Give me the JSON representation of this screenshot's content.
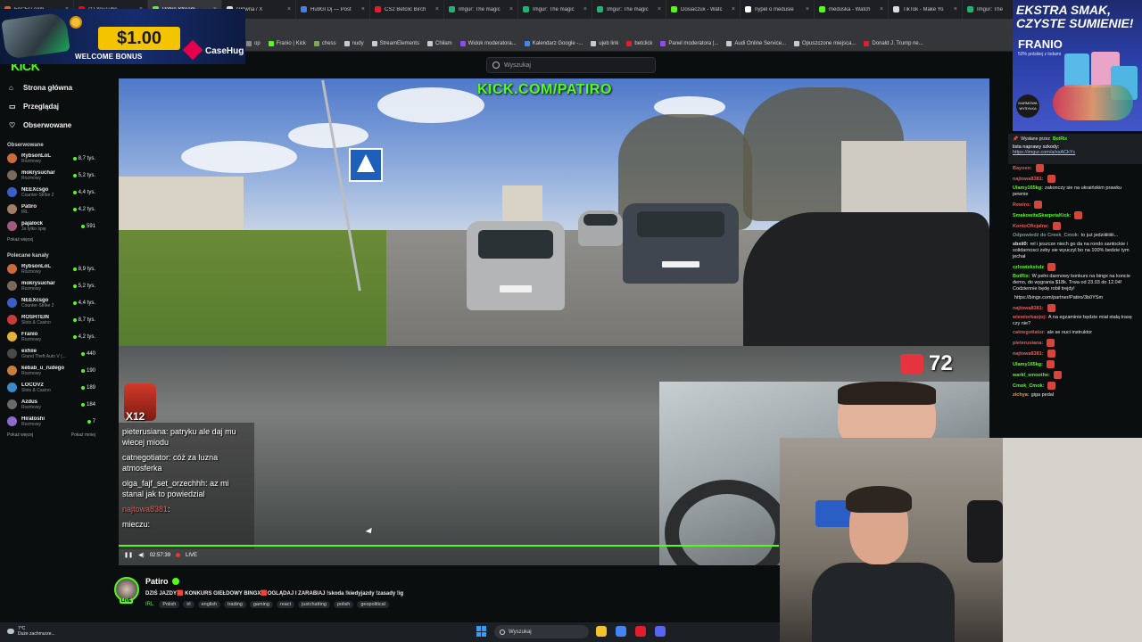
{
  "browser": {
    "tabs": [
      {
        "label": "FACEIT.com",
        "color": "#ff5500",
        "active": false
      },
      {
        "label": "(1) YouTube",
        "color": "#ff0000",
        "active": false
      },
      {
        "label": "Patiro Stream",
        "color": "#53fc18",
        "active": true
      },
      {
        "label": "Główna / X",
        "color": "#dddddd",
        "active": false
      },
      {
        "label": "Hu9Gl Dj — Post",
        "color": "#3b82f6",
        "active": false
      },
      {
        "label": "CS2 Betclic Birch",
        "color": "#e11d2e",
        "active": false
      },
      {
        "label": "Imgur: The magic",
        "color": "#1bb76e",
        "active": false
      },
      {
        "label": "Imgur: The magic",
        "color": "#1bb76e",
        "active": false
      },
      {
        "label": "Imgur: The magic",
        "color": "#1bb76e",
        "active": false
      },
      {
        "label": "Dosiaczux - Watc",
        "color": "#53fc18",
        "active": false
      },
      {
        "label": "nypel o medusie",
        "color": "#ffffff",
        "active": false
      },
      {
        "label": "meduska - Watch",
        "color": "#53fc18",
        "active": false
      },
      {
        "label": "TikTok - Make Yo",
        "color": "#dddddd",
        "active": false
      },
      {
        "label": "Imgur: The",
        "color": "#1bb76e",
        "active": false
      }
    ],
    "tab_close": "×",
    "bookmarks": [
      {
        "label": "op",
        "color": "#888888"
      },
      {
        "label": "Franio | Kick",
        "color": "#53fc18"
      },
      {
        "label": "chess",
        "color": "#7fa650"
      },
      {
        "label": "nudy",
        "color": "#c9c9c9"
      },
      {
        "label": "StreamElements",
        "color": "#c9c9c9"
      },
      {
        "label": "Chiłam",
        "color": "#c9c9c9"
      },
      {
        "label": "Widok moderatora...",
        "color": "#9146ff"
      },
      {
        "label": "Kalendarz Google -...",
        "color": "#4285f4"
      },
      {
        "label": "ujeb link",
        "color": "#c9c9c9"
      },
      {
        "label": "betclick",
        "color": "#e11d2e"
      },
      {
        "label": "Panel moderatora |...",
        "color": "#9146ff"
      },
      {
        "label": "Audi Online Service...",
        "color": "#c9c9c9"
      },
      {
        "label": "Opuszczone miejsca...",
        "color": "#c9c9c9"
      },
      {
        "label": "Donald J. Trump ne...",
        "color": "#e11d2e"
      }
    ]
  },
  "ad_left": {
    "amount": "$1.00",
    "text": "WELCOME BONUS",
    "brand": "CaseHug"
  },
  "ad_right": {
    "line1": "EKSTRA SMAK, CZYSTE SUMIENIE!",
    "line2": "FRANIO",
    "line3": "50% polskiej z lodami",
    "badge": "DARMOWA WYSYŁKA"
  },
  "header": {
    "logo": "KICK",
    "search_placeholder": "Wyszukaj",
    "menu": "≡"
  },
  "sidebar": {
    "nav": [
      {
        "label": "Strona główna",
        "icon": "home-icon",
        "glyph": "⌂"
      },
      {
        "label": "Przeglądaj",
        "icon": "browse-icon",
        "glyph": "▭"
      },
      {
        "label": "Obserwowane",
        "icon": "heart-icon",
        "glyph": "♡"
      }
    ],
    "followed_title": "Obserwowane",
    "followed": [
      {
        "name": "RybsonLoL",
        "category": "Rozmowy",
        "viewers": "8,7 tys.",
        "color": "#c96b3b"
      },
      {
        "name": "mokrysuchar",
        "category": "Rozmowy",
        "viewers": "5,2 tys.",
        "color": "#7b6a5c"
      },
      {
        "name": "NEEXcsgo",
        "category": "Counter-Strike 2",
        "viewers": "4,4 tys.",
        "color": "#3b5ec9"
      },
      {
        "name": "Patiro",
        "category": "IRL",
        "viewers": "4,2 tys.",
        "color": "#a37d64"
      },
      {
        "name": "pajalock",
        "category": "Ja tylko śpię",
        "viewers": "591",
        "color": "#a05b7f"
      }
    ],
    "show_more_1": "Pokaż więcej",
    "recommended_title": "Polecane kanały",
    "recommended": [
      {
        "name": "RybsonLoL",
        "category": "Rozmowy",
        "viewers": "8,9 tys.",
        "color": "#c96b3b"
      },
      {
        "name": "mokrysuchar",
        "category": "Rozmowy",
        "viewers": "5,2 tys.",
        "color": "#7b6a5c"
      },
      {
        "name": "NEEXcsgo",
        "category": "Counter-Strike 2",
        "viewers": "4,4 tys.",
        "color": "#3b5ec9"
      },
      {
        "name": "ROSHTEIN",
        "category": "Slots & Casino",
        "viewers": "8,7 tys.",
        "color": "#c93b3b"
      },
      {
        "name": "Franio",
        "category": "Rozmowy",
        "viewers": "4,2 tys.",
        "color": "#e3b23a"
      },
      {
        "name": "exhiie",
        "category": "Grand Theft Auto V (...",
        "viewers": "440",
        "color": "#4a4a4a"
      },
      {
        "name": "kebab_u_rudego",
        "category": "Rozmowy",
        "viewers": "190",
        "color": "#c97e3b"
      },
      {
        "name": "LOCOV2",
        "category": "Slots & Casino",
        "viewers": "189",
        "color": "#3b8ac9"
      },
      {
        "name": "Azdus",
        "category": "Rozmowy",
        "viewers": "184",
        "color": "#6a6a6a"
      },
      {
        "name": "Hiratoshi",
        "category": "Rozmowy",
        "viewers": "7",
        "color": "#8f6ac9"
      }
    ],
    "show_more_2": "Pokaż więcej",
    "show_less": "Pokaż mniej"
  },
  "video": {
    "watermark": "KICK.COM/PATIRO",
    "heart_rate": "72",
    "emote_count": "X12",
    "overlay_chat": [
      {
        "user": "pieterusiana",
        "text": ": patryku ale daj mu wiecej miodu",
        "red": false
      },
      {
        "user": "catnegotiator",
        "text": ": cóż za luzna atmosferka",
        "red": false
      },
      {
        "user": "olga_fajf_set_orzechhh",
        "text": ": az mi stanal jak to powiedzial",
        "red": false
      },
      {
        "user": "najtowa8381",
        "text": ":",
        "red": true
      },
      {
        "user": "mieczu",
        "text": ":",
        "red": false
      }
    ],
    "time": "02:57:39",
    "live": "LIVE"
  },
  "stream_info": {
    "name": "Patiro",
    "live_badge": "LIVE",
    "title": "DZIŚ JAZDY🟥 KONKURS GIEŁDOWY BINGX🟥OGLĄDAJ I ZARABIAJ !skoda !kiedyjazdy !zasady !ig",
    "category": "IRL",
    "tags": [
      "Polish",
      "irl",
      "english",
      "trading",
      "gaming",
      "react",
      "justchatting",
      "polish",
      "geopolitical"
    ]
  },
  "chat": {
    "pinned_by": "Wysłane przez",
    "pinned_bot": "BotRix",
    "pinned_text": "lista naprawy szkody:",
    "pinned_link": "https://imgur.com/a/xsACkYc",
    "messages": [
      {
        "user": "Bayoen:",
        "text": "",
        "color": "#e85a5a"
      },
      {
        "user": "najtowa8381:",
        "text": "",
        "color": "#e85a5a"
      },
      {
        "user": "Ulamy165kg:",
        "text": "zakonczy sie na ukraińskim prawku pewnie",
        "color": "#53fc18"
      },
      {
        "user": "Rewiro:",
        "text": "",
        "color": "#e85a5a"
      },
      {
        "user": "SmakowitaSkarpetaKick:",
        "text": "",
        "color": "#53fc18"
      },
      {
        "user": "KontoOficjalne:",
        "text": "",
        "color": "#e85a5a"
      },
      {
        "user": "Odpowiedź do Creek_Cmok:",
        "text": "to już jedziiiiiiiiii...",
        "color": "#8b9297"
      },
      {
        "user": "sbxii0:",
        "text": "rel i jeszcze niech go da na rondo santockie i solidarnosci zeby sie wyuczyl bo na 100% bedzie tym jechał",
        "color": "#e9e9e9"
      },
      {
        "user": "czlowiekstulz",
        "text": "",
        "color": "#53fc18"
      },
      {
        "user": "BotRix:",
        "text": "W pełni darmowy konkurs na bingx na koncie demo, do wygrania $18k. Trwa od 23.03 do 12.04! Codziennie będę robił trejdy!",
        "color": "#53fc18"
      },
      {
        "user": "",
        "text": "https://bingx.com/partner/Patiro/3b0YSm",
        "color": "#a7c7ff"
      },
      {
        "user": "najtowa8381:",
        "text": "",
        "color": "#e85a5a"
      },
      {
        "user": "wiewiorkaojoj:",
        "text": "A na egzaminie będzie miał stałą trasę czy nie?",
        "color": "#e85a5a"
      },
      {
        "user": "catnegotiator:",
        "text": "ale se nuci instruktor",
        "color": "#e85a5a"
      },
      {
        "user": "pieterusiana:",
        "text": "",
        "color": "#e85a5a"
      },
      {
        "user": "najtowa8381:",
        "text": "",
        "color": "#e85a5a"
      },
      {
        "user": "Ulamy165kg:",
        "text": "",
        "color": "#53fc18"
      },
      {
        "user": "warkl_smoothe:",
        "text": "",
        "color": "#53fc18"
      },
      {
        "user": "Cmok_Cmok:",
        "text": "",
        "color": "#53fc18"
      },
      {
        "user": "zichya:",
        "text": "giga pedal",
        "color": "#e9a03a"
      }
    ]
  },
  "taskbar": {
    "temp": "7°C",
    "weather": "Duże zachmurze...",
    "search_placeholder": "Wyszukaj",
    "apps": [
      {
        "name": "file-explorer-icon",
        "color": "#f2c230"
      },
      {
        "name": "chrome-icon",
        "color": "#4285f4"
      },
      {
        "name": "app-red-icon",
        "color": "#e11d2e"
      },
      {
        "name": "discord-icon",
        "color": "#5865f2"
      }
    ]
  }
}
